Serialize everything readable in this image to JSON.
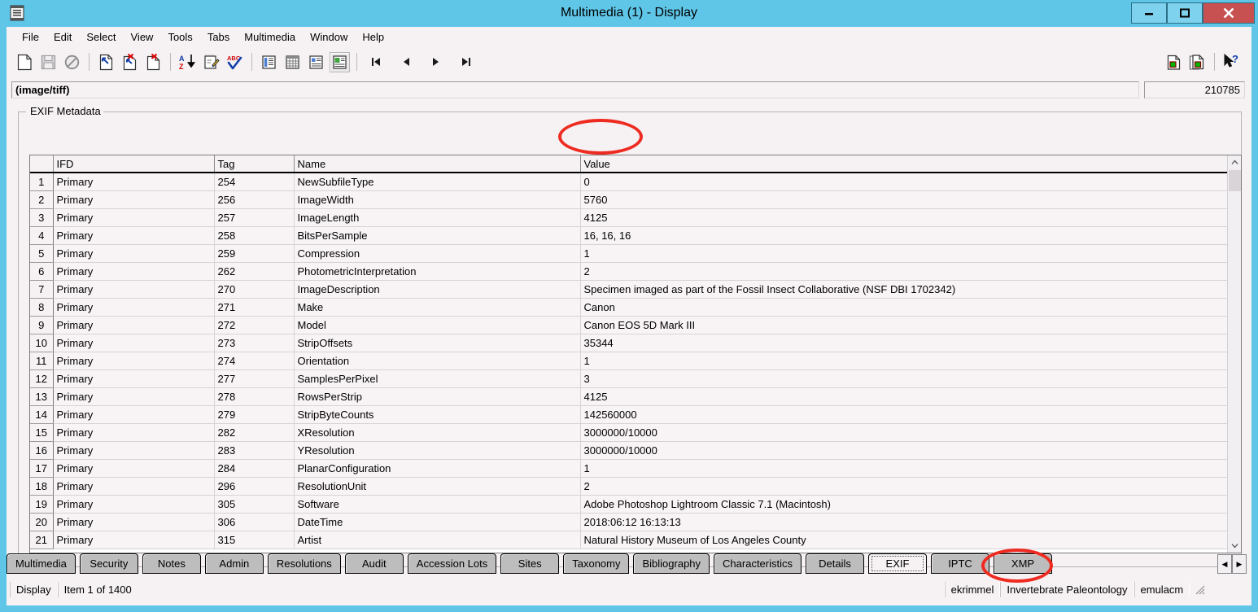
{
  "window": {
    "title": "Multimedia (1) - Display",
    "icon": "application-icon",
    "controls": {
      "minimize": "–",
      "maximize": "❐",
      "close": "✕"
    },
    "colors": {
      "titlebar": "#5FC6E8",
      "close_button": "#C75050",
      "client": "#F6F2F4",
      "tab_inactive": "#BDBDBD",
      "annotation": "#EE2B21"
    }
  },
  "menubar": {
    "items": [
      {
        "label": "File"
      },
      {
        "label": "Edit"
      },
      {
        "label": "Select"
      },
      {
        "label": "View"
      },
      {
        "label": "Tools"
      },
      {
        "label": "Tabs"
      },
      {
        "label": "Multimedia"
      },
      {
        "label": "Window"
      },
      {
        "label": "Help"
      }
    ]
  },
  "toolbar": {
    "left_groups": [
      [
        {
          "name": "new-record-icon",
          "title": "New"
        },
        {
          "name": "save-icon",
          "title": "Save"
        },
        {
          "name": "cancel-icon",
          "title": "Cancel"
        }
      ],
      [
        {
          "name": "duplicate-record-icon",
          "title": "Duplicate"
        },
        {
          "name": "delete-record-icon",
          "title": "Delete"
        },
        {
          "name": "delete-page-icon",
          "title": "Delete page"
        }
      ],
      [
        {
          "name": "sort-az-icon",
          "title": "Sort"
        },
        {
          "name": "edit-notes-icon",
          "title": "Edit"
        },
        {
          "name": "spellcheck-icon",
          "title": "Spell check"
        }
      ],
      [
        {
          "name": "list-view-icon",
          "title": "List view"
        },
        {
          "name": "grid-view-icon",
          "title": "Grid view"
        },
        {
          "name": "form-view-icon",
          "title": "Form view"
        },
        {
          "name": "display-view-icon",
          "title": "Display view",
          "pressed": true
        }
      ],
      [
        {
          "name": "first-record-icon",
          "title": "First"
        },
        {
          "name": "previous-record-icon",
          "title": "Previous"
        },
        {
          "name": "next-record-icon",
          "title": "Next"
        },
        {
          "name": "last-record-icon",
          "title": "Last"
        }
      ]
    ],
    "right_group": [
      {
        "name": "copy-record-icon",
        "title": "Copy record"
      },
      {
        "name": "paste-record-icon",
        "title": "Paste record"
      },
      {
        "name": "help-pointer-icon",
        "title": "What's this?"
      }
    ]
  },
  "mimebar": {
    "mime_value": "(image/tiff)",
    "mime_placeholder": "",
    "count_value": "210785"
  },
  "groupbox": {
    "legend": "EXIF Metadata"
  },
  "grid": {
    "columns": [
      "",
      "IFD",
      "Tag",
      "Name",
      "Value"
    ],
    "rows": [
      {
        "n": "1",
        "ifd": "Primary",
        "tag": "254",
        "name": "NewSubfileType",
        "value": "0"
      },
      {
        "n": "2",
        "ifd": "Primary",
        "tag": "256",
        "name": "ImageWidth",
        "value": "5760"
      },
      {
        "n": "3",
        "ifd": "Primary",
        "tag": "257",
        "name": "ImageLength",
        "value": "4125"
      },
      {
        "n": "4",
        "ifd": "Primary",
        "tag": "258",
        "name": "BitsPerSample",
        "value": "16, 16, 16"
      },
      {
        "n": "5",
        "ifd": "Primary",
        "tag": "259",
        "name": "Compression",
        "value": "1"
      },
      {
        "n": "6",
        "ifd": "Primary",
        "tag": "262",
        "name": "PhotometricInterpretation",
        "value": "2"
      },
      {
        "n": "7",
        "ifd": "Primary",
        "tag": "270",
        "name": "ImageDescription",
        "value": "Specimen imaged as part of the Fossil Insect Collaborative (NSF DBI 1702342)"
      },
      {
        "n": "8",
        "ifd": "Primary",
        "tag": "271",
        "name": "Make",
        "value": "Canon"
      },
      {
        "n": "9",
        "ifd": "Primary",
        "tag": "272",
        "name": "Model",
        "value": "Canon EOS 5D Mark III"
      },
      {
        "n": "10",
        "ifd": "Primary",
        "tag": "273",
        "name": "StripOffsets",
        "value": "35344"
      },
      {
        "n": "11",
        "ifd": "Primary",
        "tag": "274",
        "name": "Orientation",
        "value": "1"
      },
      {
        "n": "12",
        "ifd": "Primary",
        "tag": "277",
        "name": "SamplesPerPixel",
        "value": "3"
      },
      {
        "n": "13",
        "ifd": "Primary",
        "tag": "278",
        "name": "RowsPerStrip",
        "value": "4125"
      },
      {
        "n": "14",
        "ifd": "Primary",
        "tag": "279",
        "name": "StripByteCounts",
        "value": "142560000"
      },
      {
        "n": "15",
        "ifd": "Primary",
        "tag": "282",
        "name": "XResolution",
        "value": "3000000/10000"
      },
      {
        "n": "16",
        "ifd": "Primary",
        "tag": "283",
        "name": "YResolution",
        "value": "3000000/10000"
      },
      {
        "n": "17",
        "ifd": "Primary",
        "tag": "284",
        "name": "PlanarConfiguration",
        "value": "1"
      },
      {
        "n": "18",
        "ifd": "Primary",
        "tag": "296",
        "name": "ResolutionUnit",
        "value": "2"
      },
      {
        "n": "19",
        "ifd": "Primary",
        "tag": "305",
        "name": "Software",
        "value": "Adobe Photoshop Lightroom Classic 7.1 (Macintosh)"
      },
      {
        "n": "20",
        "ifd": "Primary",
        "tag": "306",
        "name": "DateTime",
        "value": "2018:06:12 16:13:13"
      },
      {
        "n": "21",
        "ifd": "Primary",
        "tag": "315",
        "name": "Artist",
        "value": "Natural History Museum of Los Angeles County"
      }
    ],
    "scrollbar": {
      "up_arrow": "⌃",
      "down_arrow": "⌄"
    }
  },
  "tabs": {
    "items": [
      {
        "label": "Multimedia",
        "active": false
      },
      {
        "label": "Security",
        "active": false
      },
      {
        "label": "Notes",
        "active": false
      },
      {
        "label": "Admin",
        "active": false
      },
      {
        "label": "Resolutions",
        "active": false
      },
      {
        "label": "Audit",
        "active": false
      },
      {
        "label": "Accession Lots",
        "active": false
      },
      {
        "label": "Sites",
        "active": false
      },
      {
        "label": "Taxonomy",
        "active": false
      },
      {
        "label": "Bibliography",
        "active": false
      },
      {
        "label": "Characteristics",
        "active": false
      },
      {
        "label": "Details",
        "active": false
      },
      {
        "label": "EXIF",
        "active": true
      },
      {
        "label": "IPTC",
        "active": false
      },
      {
        "label": "XMP",
        "active": false
      }
    ],
    "nav_prev": "◀",
    "nav_next": "▶"
  },
  "statusbar": {
    "mode": "Display",
    "record_position": "Item 1 of 1400",
    "user": "ekrimmel",
    "collection": "Invertebrate Paleontology",
    "database": "emulacm"
  },
  "annotations": [
    {
      "name": "value-column-highlight",
      "target": "Value"
    },
    {
      "name": "exif-tab-highlight",
      "target": "EXIF"
    }
  ]
}
